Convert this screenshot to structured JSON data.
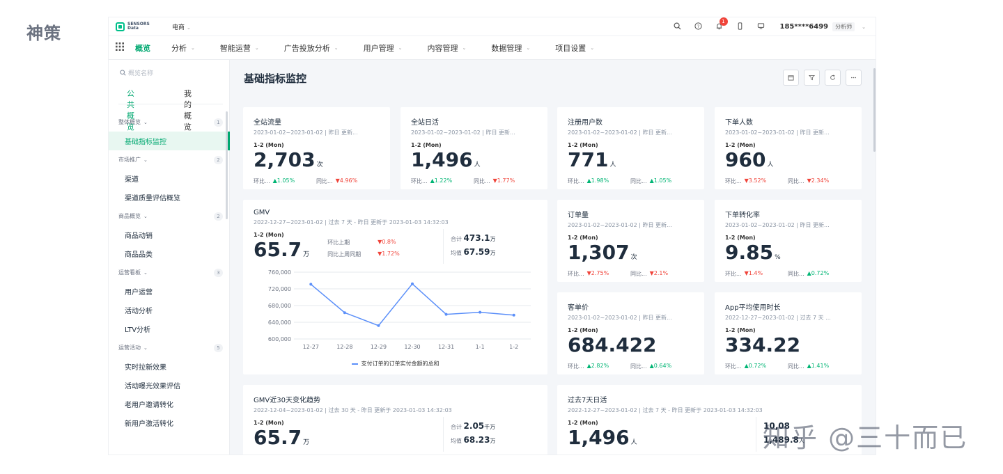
{
  "page_label": "神策",
  "topbar": {
    "logo_text": "SENSORS Data",
    "project": "电商",
    "notification_count": "1",
    "user": "185****6499",
    "role": "分析师"
  },
  "nav": {
    "items": [
      "概览",
      "分析",
      "智能运营",
      "广告投放分析",
      "用户管理",
      "内容管理",
      "数据管理",
      "项目设置"
    ]
  },
  "sidebar": {
    "search_placeholder": "概览名称",
    "tabs": [
      "公共概览",
      "我的概览"
    ],
    "groups": [
      {
        "label": "整体概览",
        "count": "1",
        "items": [
          "基础指标监控"
        ]
      },
      {
        "label": "市场推广",
        "count": "2",
        "items": [
          "渠道",
          "渠道质量评估概览"
        ]
      },
      {
        "label": "商品概览",
        "count": "2",
        "items": [
          "商品动销",
          "商品品类"
        ]
      },
      {
        "label": "运营看板",
        "count": "3",
        "items": [
          "用户运营",
          "活动分析",
          "LTV分析"
        ]
      },
      {
        "label": "运营活动",
        "count": "5",
        "items": [
          "实时拉新效果",
          "活动曝光效果评估",
          "老用户邀请转化",
          "新用户激活转化"
        ]
      }
    ]
  },
  "main": {
    "title": "基础指标监控",
    "cards": [
      {
        "title": "全站流量",
        "sub": "2023-01-02~2023-01-02 | 昨日 更新...",
        "date": "1-2 (Mon)",
        "value": "2,703",
        "unit": "次",
        "cmp1_label": "环比...",
        "cmp1": "▲1.05%",
        "cmp2_label": "同比...",
        "cmp2": "▼4.96%"
      },
      {
        "title": "全站日活",
        "sub": "2023-01-02~2023-01-02 | 昨日 更新...",
        "date": "1-2 (Mon)",
        "value": "1,496",
        "unit": "人",
        "cmp1_label": "环比...",
        "cmp1": "▲1.22%",
        "cmp2_label": "同比...",
        "cmp2": "▼1.77%"
      },
      {
        "title": "注册用户数",
        "sub": "2023-01-02~2023-01-02 | 昨日 更新...",
        "date": "1-2 (Mon)",
        "value": "771",
        "unit": "人",
        "cmp1_label": "环比...",
        "cmp1": "▲1.98%",
        "cmp2_label": "同比...",
        "cmp2": "▲1.05%"
      },
      {
        "title": "下单人数",
        "sub": "2023-01-02~2023-01-02 | 昨日 更新...",
        "date": "1-2 (Mon)",
        "value": "960",
        "unit": "人",
        "cmp1_label": "环比...",
        "cmp1": "▼3.52%",
        "cmp2_label": "同比...",
        "cmp2": "▼2.34%"
      },
      {
        "title": "订单量",
        "sub": "2023-01-02~2023-01-02 | 昨日 更新...",
        "date": "1-2 (Mon)",
        "value": "1,307",
        "unit": "次",
        "cmp1_label": "环比...",
        "cmp1": "▼2.75%",
        "cmp2_label": "同比...",
        "cmp2": "▼2.1%"
      },
      {
        "title": "下单转化率",
        "sub": "2023-01-02~2023-01-02 | 昨日 更新...",
        "date": "1-2 (Mon)",
        "value": "9.85",
        "unit": "%",
        "cmp1_label": "环比...",
        "cmp1": "▼1.4%",
        "cmp2_label": "同比...",
        "cmp2": "▲0.72%"
      },
      {
        "title": "客单价",
        "sub": "2023-01-02~2023-01-02 | 昨日 更新...",
        "date": "1-2 (Mon)",
        "value": "684.422",
        "unit": "",
        "cmp1_label": "环比...",
        "cmp1": "▲2.82%",
        "cmp2_label": "同比...",
        "cmp2": "▲0.64%"
      },
      {
        "title": "App平均使用时长",
        "sub": "2022-12-27~2023-01-02 | 过去 7 天 ...",
        "date": "1-2 (Mon)",
        "value": "334.22",
        "unit": "",
        "cmp1_label": "环比...",
        "cmp1": "▲0.72%",
        "cmp2_label": "同比...",
        "cmp2": "▲1.41%"
      }
    ],
    "gmv": {
      "title": "GMV",
      "sub": "2022-12-27~2023-01-02 | 过去 7 天 - 昨日 更新于 2023-01-03 14:32:03",
      "date": "1-2 (Mon)",
      "value": "65.7",
      "unit": "万",
      "cmp1_label": "环比上期",
      "cmp1": "▼0.8%",
      "cmp2_label": "同比上周同期",
      "cmp2": "▼1.72%",
      "total_label": "合计",
      "total": "473.1",
      "total_unit": "万",
      "avg_label": "均值",
      "avg": "67.59",
      "avg_unit": "万"
    },
    "gmv30": {
      "title": "GMV近30天变化趋势",
      "sub": "2022-12-04~2023-01-02 | 过去 30 天 - 昨日 更新于 2023-01-03 14:32:03",
      "date": "1-2 (Mon)",
      "value": "65.7",
      "unit": "万",
      "total_label": "合计",
      "total": "2.05",
      "total_unit": "千万",
      "avg_label": "均值",
      "avg": "68.23",
      "avg_unit": "万"
    },
    "dau7": {
      "title": "过去7天日活",
      "sub": "2022-12-27~2023-01-02 | 过去 7 天 - 昨日 更新于 2023-01-03 14:32:03",
      "date": "1-2 (Mon)",
      "value": "1,496",
      "unit": "人",
      "total_fragment": "10,08",
      "avg_fragment": "1,489.8",
      "avg_unit": "人"
    }
  },
  "chart_data": {
    "type": "line",
    "categories": [
      "12-27",
      "12-28",
      "12-29",
      "12-30",
      "12-31",
      "1-1",
      "1-2"
    ],
    "series": [
      {
        "name": "支付订单的订单实付金额的总和",
        "values": [
          731000,
          663000,
          632000,
          732000,
          659000,
          664000,
          657000
        ]
      }
    ],
    "yticks": [
      "760,000",
      "720,000",
      "680,000",
      "640,000",
      "600,000"
    ],
    "ylim": [
      600000,
      760000
    ],
    "grid": true,
    "legend": "bottom",
    "color": "#5b8ff9"
  },
  "watermark": "知乎 @三十而已"
}
